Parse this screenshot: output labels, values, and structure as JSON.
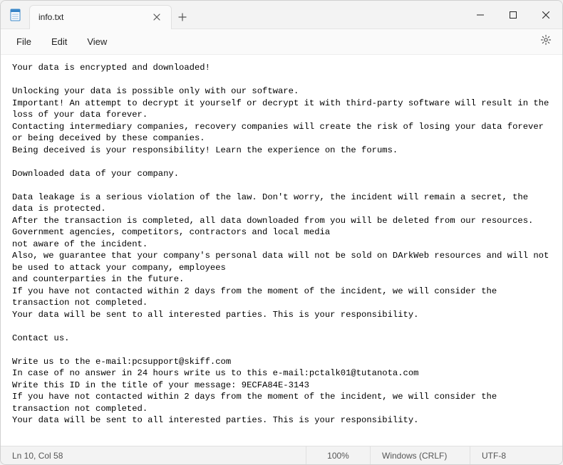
{
  "window": {
    "tab_title": "info.txt",
    "menu": {
      "file": "File",
      "edit": "Edit",
      "view": "View"
    }
  },
  "content_text": "Your data is encrypted and downloaded!\n\nUnlocking your data is possible only with our software.\nImportant! An attempt to decrypt it yourself or decrypt it with third-party software will result in the loss of your data forever.\nContacting intermediary companies, recovery companies will create the risk of losing your data forever or being deceived by these companies.\nBeing deceived is your responsibility! Learn the experience on the forums.\n\nDownloaded data of your company.\n\nData leakage is a serious violation of the law. Don't worry, the incident will remain a secret, the data is protected.\nAfter the transaction is completed, all data downloaded from you will be deleted from our resources. Government agencies, competitors, contractors and local media\nnot aware of the incident.\nAlso, we guarantee that your company's personal data will not be sold on DArkWeb resources and will not be used to attack your company, employees\nand counterparties in the future.\nIf you have not contacted within 2 days from the moment of the incident, we will consider the transaction not completed.\nYour data will be sent to all interested parties. This is your responsibility.\n\nContact us.\n\nWrite us to the e-mail:pcsupport@skiff.com\nIn case of no answer in 24 hours write us to this e-mail:pctalk01@tutanota.com\nWrite this ID in the title of your message: 9ECFA84E-3143\nIf you have not contacted within 2 days from the moment of the incident, we will consider the transaction not completed.\nYour data will be sent to all interested parties. This is your responsibility.",
  "status": {
    "position": "Ln 10, Col 58",
    "zoom": "100%",
    "line_ending": "Windows (CRLF)",
    "encoding": "UTF-8"
  }
}
